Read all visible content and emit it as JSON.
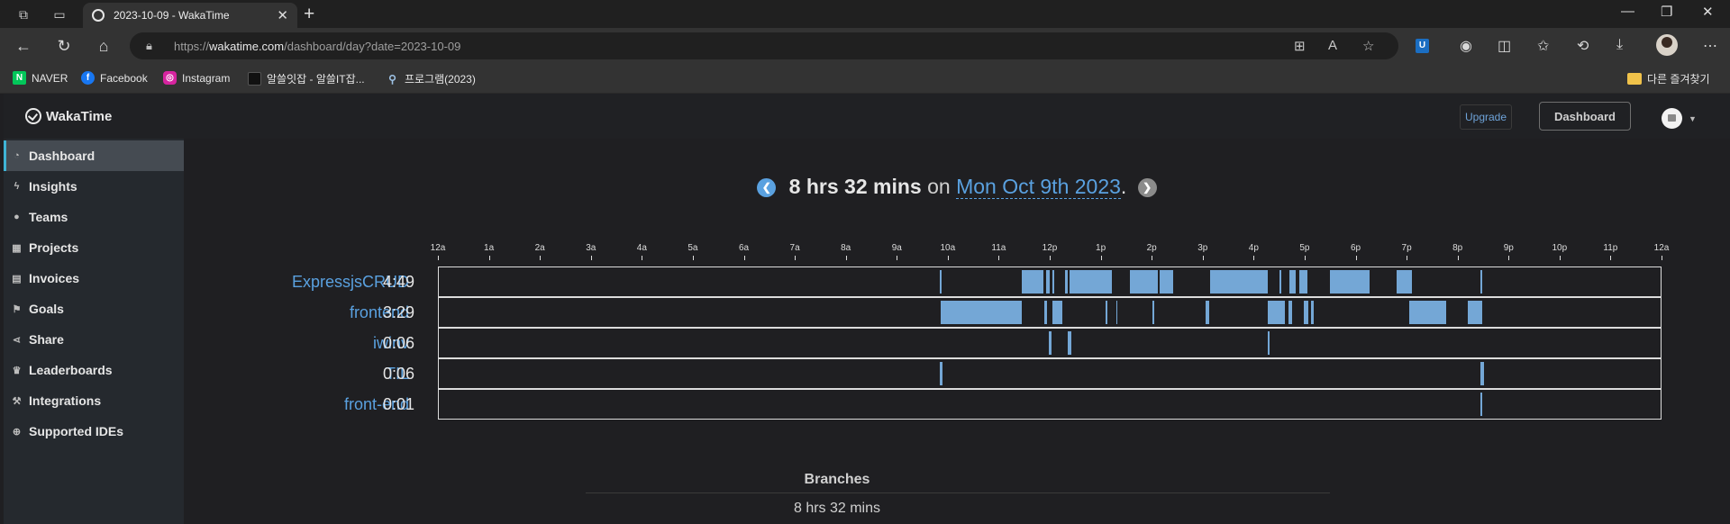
{
  "browser": {
    "tab_title": "2023-10-09 - WakaTime",
    "url_prefix": "https://",
    "url_domain": "wakatime.com",
    "url_path": "/dashboard/day?date=2023-10-09",
    "bookmarks": [
      {
        "label": "NAVER",
        "icon": "naver-icon",
        "color": "#03c75a"
      },
      {
        "label": "Facebook",
        "icon": "facebook-icon",
        "color": "#1877f2"
      },
      {
        "label": "Instagram",
        "icon": "instagram-icon",
        "color": "#d6249f"
      },
      {
        "label": "알쓸잇잡 - 알쓸IT잡...",
        "icon": "site-icon",
        "color": "#111111"
      },
      {
        "label": "프로그램(2023)",
        "icon": "search-icon",
        "color": "#333333"
      }
    ],
    "other_bookmarks": "다른 즐겨찾기"
  },
  "app": {
    "brand": "WakaTime",
    "upgrade_label": "Upgrade",
    "dashboard_label": "Dashboard"
  },
  "sidebar": {
    "items": [
      {
        "label": "Dashboard",
        "icon": "dashboard-icon",
        "active": true
      },
      {
        "label": "Insights",
        "icon": "bolt-icon"
      },
      {
        "label": "Teams",
        "icon": "users-icon"
      },
      {
        "label": "Projects",
        "icon": "grid-icon"
      },
      {
        "label": "Invoices",
        "icon": "invoice-icon"
      },
      {
        "label": "Goals",
        "icon": "flag-icon"
      },
      {
        "label": "Share",
        "icon": "share-icon"
      },
      {
        "label": "Leaderboards",
        "icon": "trophy-icon"
      },
      {
        "label": "Integrations",
        "icon": "wrench-icon"
      },
      {
        "label": "Supported IDEs",
        "icon": "plus-circle-icon"
      }
    ]
  },
  "summary": {
    "total": "8 hrs 32 mins",
    "on": "on",
    "date": "Mon Oct 9th 2023",
    "period": "."
  },
  "chart_data": {
    "type": "timeline",
    "x_ticks": [
      "12a",
      "1a",
      "2a",
      "3a",
      "4a",
      "5a",
      "6a",
      "7a",
      "8a",
      "9a",
      "10a",
      "11a",
      "12p",
      "1p",
      "2p",
      "3p",
      "4p",
      "5p",
      "6p",
      "7p",
      "8p",
      "9p",
      "10p",
      "11p",
      "12a"
    ],
    "x_range_hours": [
      0,
      24
    ],
    "bar_color": "#74a7d6",
    "rows": [
      {
        "project": "ExpressjsCRUD",
        "duration": "4:49",
        "segments": [
          [
            9.85,
            9.87
          ],
          [
            11.45,
            11.88
          ],
          [
            11.93,
            12.0
          ],
          [
            12.05,
            12.08
          ],
          [
            12.3,
            12.35
          ],
          [
            12.38,
            13.22
          ],
          [
            13.58,
            14.12
          ],
          [
            14.15,
            14.42
          ],
          [
            15.15,
            16.28
          ],
          [
            16.5,
            16.55
          ],
          [
            16.7,
            16.82
          ],
          [
            16.9,
            17.05
          ],
          [
            17.5,
            18.28
          ],
          [
            18.8,
            19.1
          ],
          [
            20.45,
            20.48
          ]
        ]
      },
      {
        "project": "frontend",
        "duration": "3:29",
        "segments": [
          [
            9.87,
            11.45
          ],
          [
            11.9,
            11.95
          ],
          [
            12.05,
            12.25
          ],
          [
            13.1,
            13.12
          ],
          [
            13.3,
            13.32
          ],
          [
            14.02,
            14.05
          ],
          [
            15.05,
            15.12
          ],
          [
            16.28,
            16.62
          ],
          [
            16.68,
            16.75
          ],
          [
            16.98,
            17.08
          ],
          [
            17.13,
            17.18
          ],
          [
            19.05,
            19.78
          ],
          [
            20.2,
            20.48
          ]
        ]
      },
      {
        "project": "iwinv",
        "duration": "0:06",
        "segments": [
          [
            11.98,
            12.03
          ],
          [
            12.35,
            12.42
          ],
          [
            16.28,
            16.3
          ]
        ]
      },
      {
        "project": "TIL",
        "duration": "0:06",
        "segments": [
          [
            9.85,
            9.9
          ],
          [
            20.45,
            20.52
          ]
        ]
      },
      {
        "project": "front-end",
        "duration": "0:01",
        "segments": [
          [
            20.45,
            20.48
          ]
        ]
      }
    ]
  },
  "branches": {
    "title": "Branches",
    "total": "8 hrs 32 mins"
  }
}
